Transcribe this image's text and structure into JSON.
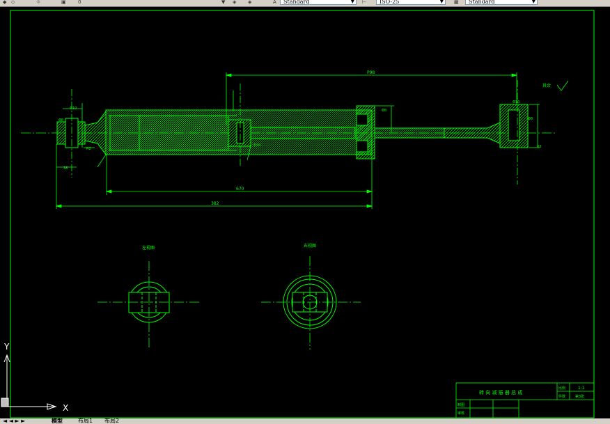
{
  "toolbar": {
    "layer_value": "0",
    "text_style": "Standard",
    "dim_style": "ISO-25",
    "table_style": "Standard"
  },
  "drawing": {
    "dim_top": "P98",
    "dim_middle": "670",
    "dim_bottom": "382",
    "label_left_view": "左视图",
    "label_right_view": "右视图",
    "roughness_note": "其余"
  },
  "title_block": {
    "title": "转 向 减 振 器 总 成",
    "scale_label": "比例",
    "scale_value": "1:1",
    "sheet_label": "件数",
    "sheet_value": "第3张",
    "designer_label": "制图",
    "checker_label": "审核"
  },
  "tabs": {
    "model": "模型",
    "layout1": "布局1",
    "layout2": "布局2"
  },
  "ucs": {
    "x": "X",
    "y": "Y"
  },
  "colors": {
    "background": "#000000",
    "lines": "#00ff00",
    "center": "#00ff00"
  }
}
